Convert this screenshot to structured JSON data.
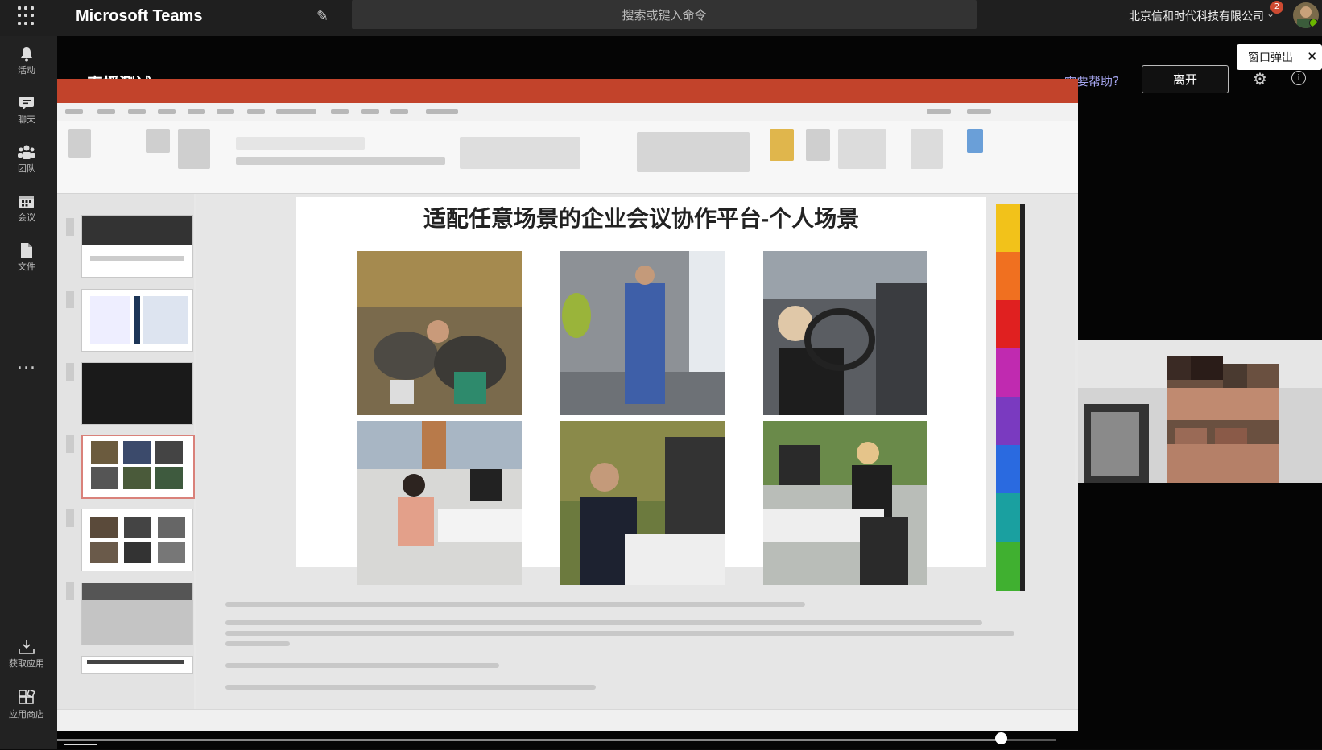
{
  "header": {
    "app_title": "Microsoft Teams",
    "search_placeholder": "搜索或键入命令",
    "org_name": "北京信和时代科技有限公司",
    "notification_count": "2"
  },
  "rail": {
    "items": [
      {
        "label": "活动",
        "icon": "bell-icon"
      },
      {
        "label": "聊天",
        "icon": "chat-icon"
      },
      {
        "label": "团队",
        "icon": "teams-icon"
      },
      {
        "label": "会议",
        "icon": "calendar-icon"
      },
      {
        "label": "文件",
        "icon": "file-icon"
      }
    ],
    "more": "...",
    "bottom": [
      {
        "label": "获取应用",
        "icon": "download-icon"
      },
      {
        "label": "应用商店",
        "icon": "apps-icon"
      }
    ]
  },
  "meeting": {
    "title": "直播测试",
    "help_link": "需要帮助?",
    "leave_button": "离开",
    "popout_tooltip": "窗口弹出"
  },
  "shared_slide": {
    "title": "适配任意场景的企业会议协作平台-个人场景"
  },
  "colors": {
    "accent_red": "#c2432b",
    "badge": "#cc4a31",
    "presence": "#6bb700",
    "link": "#a6a6f0"
  }
}
